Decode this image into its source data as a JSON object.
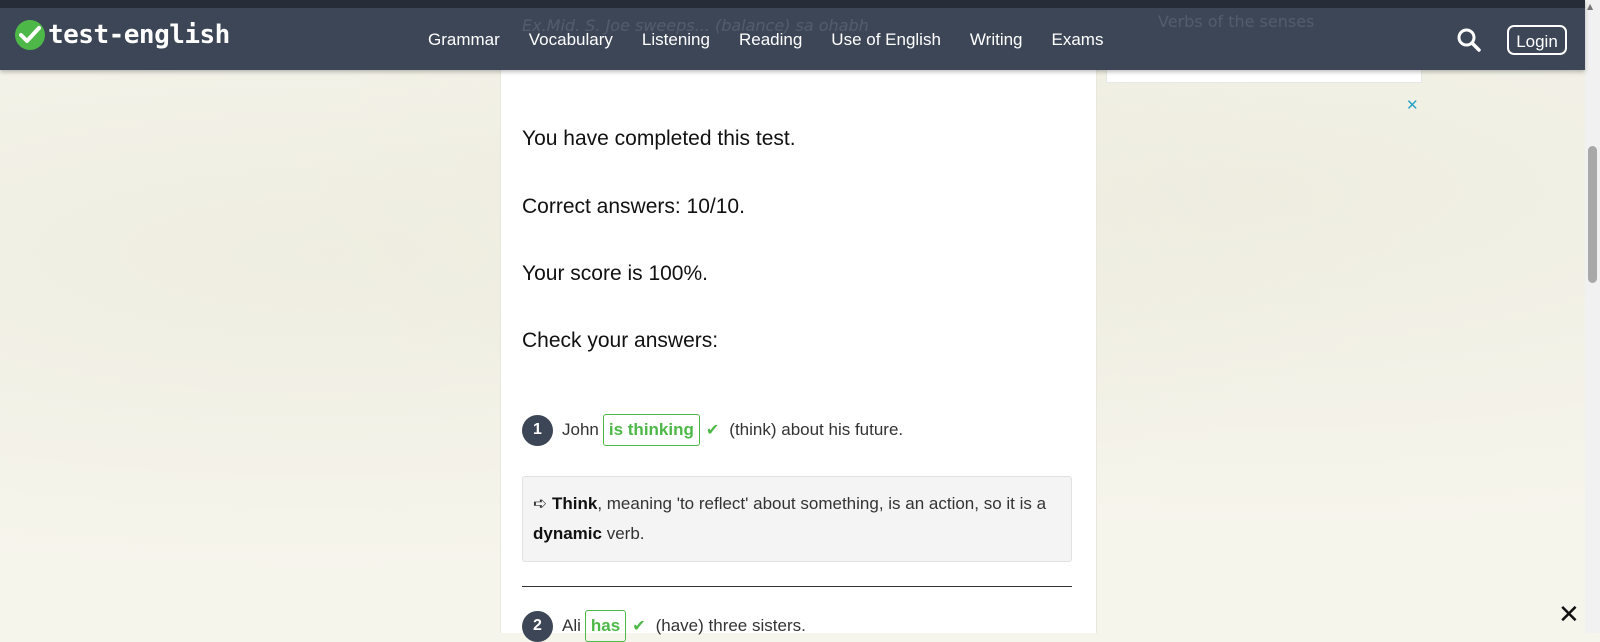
{
  "header": {
    "logo_text": "test-english",
    "nav": [
      "Grammar",
      "Vocabulary",
      "Listening",
      "Reading",
      "Use of English",
      "Writing",
      "Exams"
    ],
    "login_label": "Login",
    "peek_left_text": "Ex.Mid. S. Joe sweeps... (balance) sa ohabh",
    "peek_right_text": "Verbs of the senses"
  },
  "results": {
    "completed": "You have completed this test.",
    "correct": "Correct answers: 10/10.",
    "score": "Your score is 100%.",
    "check": "Check your answers:"
  },
  "questions": [
    {
      "number": "1",
      "before": "John",
      "answer": "is thinking",
      "after": "(think) about his future.",
      "explanation": {
        "arrow": "➪",
        "term": "Think",
        "text1": ", meaning 'to reflect' about something, is an action, so it is a ",
        "emph": "dynamic",
        "text2": " verb."
      }
    },
    {
      "number": "2",
      "before": "Ali",
      "answer": "has",
      "after": "(have) three sisters."
    }
  ],
  "ad_close": "✕",
  "close_label": "✕",
  "colors": {
    "header": "#3c4656",
    "correct": "#4db848",
    "ad_close": "#2aa3c7"
  }
}
